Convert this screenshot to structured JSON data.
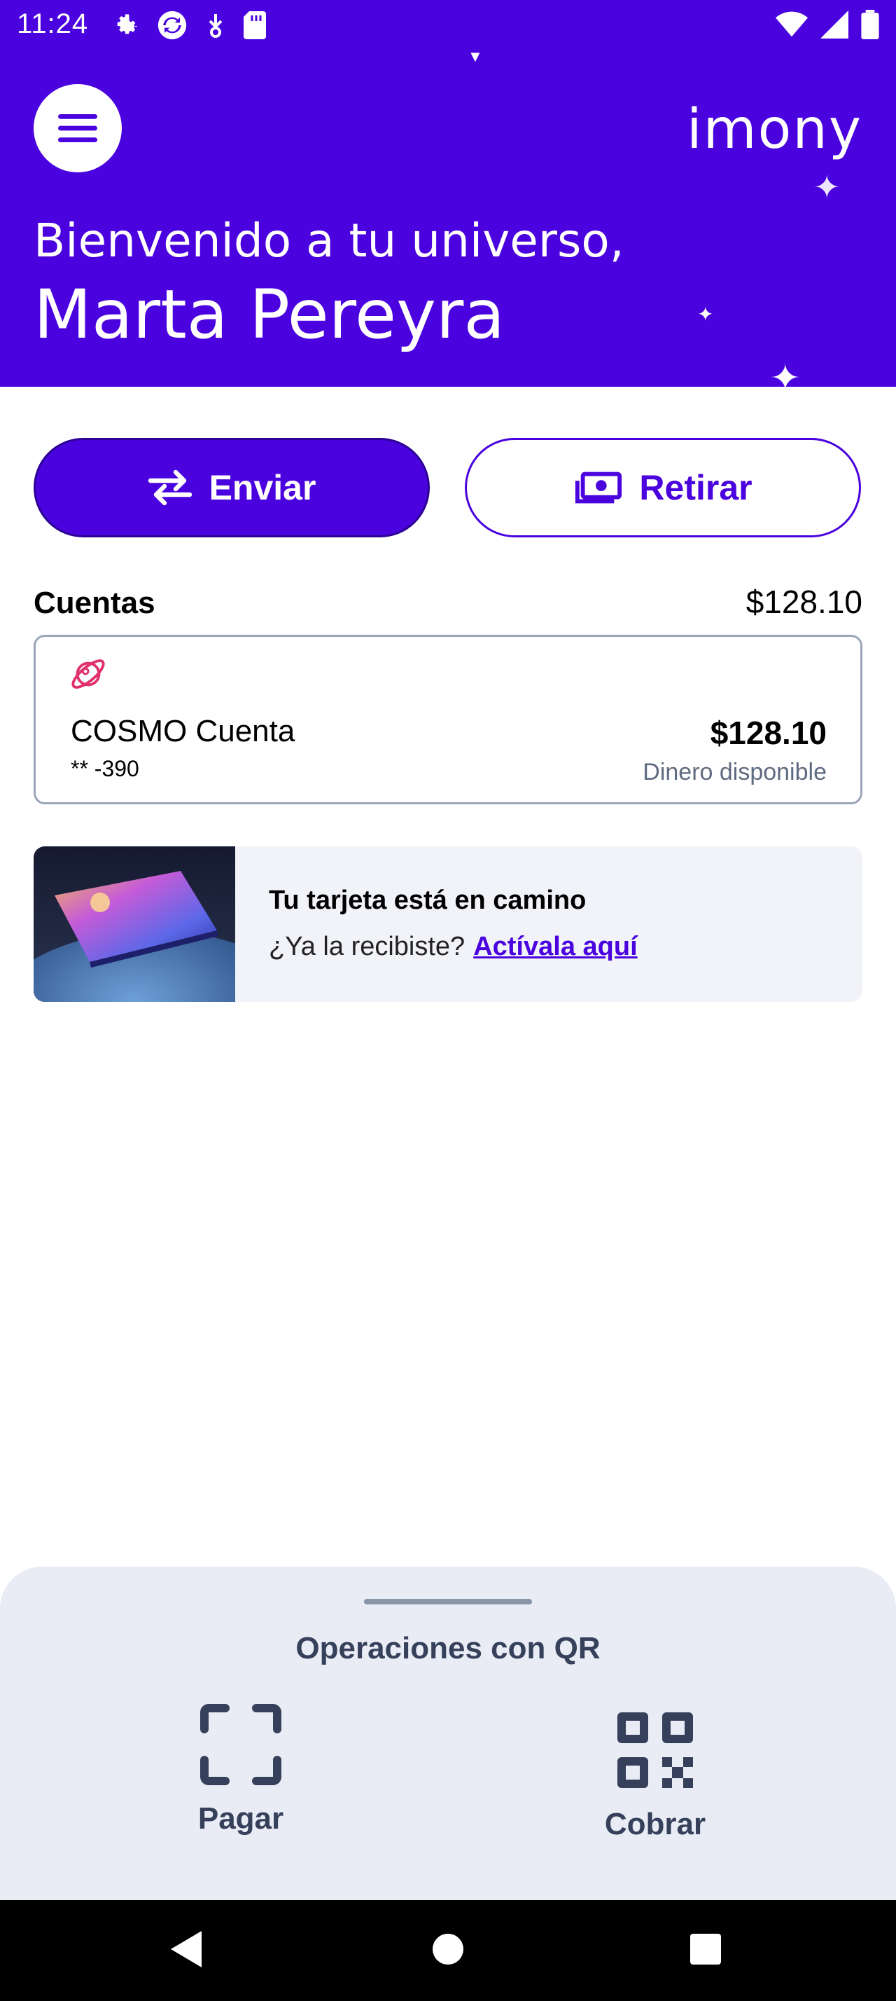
{
  "status_bar": {
    "time": "11:24"
  },
  "header": {
    "logo_text": "imony",
    "greeting": "Bienvenido a tu universo,",
    "user_name": "Marta Pereyra"
  },
  "actions": {
    "send_label": "Enviar",
    "withdraw_label": "Retirar"
  },
  "accounts": {
    "title": "Cuentas",
    "total": "$128.10",
    "items": [
      {
        "name": "COSMO Cuenta",
        "number": "** -390",
        "balance": "$128.10",
        "balance_caption": "Dinero disponible"
      }
    ]
  },
  "promo": {
    "title": "Tu tarjeta está en camino",
    "text": "¿Ya la recibiste?",
    "link": "Actívala aquí"
  },
  "qr_operations": {
    "title": "Operaciones con QR",
    "pay_label": "Pagar",
    "charge_label": "Cobrar"
  },
  "colors": {
    "brand": "#4a02de",
    "qr_text": "#36405a",
    "sheet_bg": "#e9ecf5"
  }
}
